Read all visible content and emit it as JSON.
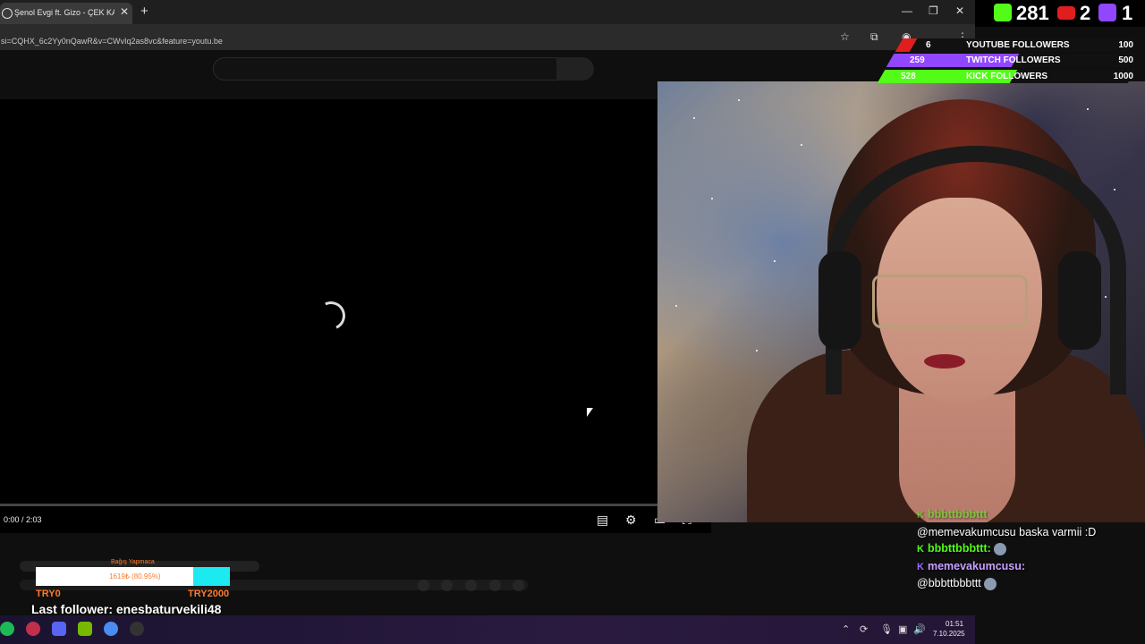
{
  "browser": {
    "tab_title": "Şenol Evgi ft. Gizo - ÇEK KAMER",
    "url": "si=CQHX_6c2Yy0nQawR&v=CWvIq2as8vc&feature=youtu.be",
    "new_tab": "+",
    "close": "✕",
    "minimize": "—",
    "restore": "❐",
    "win_close": "✕",
    "star": "☆"
  },
  "player": {
    "time": "0:00 / 2:03"
  },
  "donation": {
    "title": "Bağış Yapmaca",
    "text": "1619₺ (80.95%)",
    "progress": 0.8095,
    "min_label": "TRY0",
    "max_label": "TRY2000"
  },
  "last_follower": "Last follower: enesbaturvekili48",
  "counters": {
    "kick": "281",
    "youtube": "2",
    "twitch": "1"
  },
  "goals": [
    {
      "current": "6",
      "label": "YOUTUBE FOLLOWERS",
      "target": "100",
      "color": "#e01e1e",
      "progress": 0.06
    },
    {
      "current": "259",
      "label": "TWITCH FOLLOWERS",
      "target": "500",
      "color": "#9146ff",
      "progress": 0.518
    },
    {
      "current": "528",
      "label": "KICK FOLLOWERS",
      "target": "1000",
      "color": "#53fc18",
      "progress": 0.528
    }
  ],
  "chat": [
    {
      "badge": "K",
      "name": "bbbttbbbttt",
      "message": "",
      "faded": true
    },
    {
      "badge": "",
      "name": "",
      "message": "@memevakumcusu baska varmii :D"
    },
    {
      "badge": "K",
      "name": "bbbttbbbttt:",
      "message": ""
    },
    {
      "badge": "K",
      "name": "memevakumcusu:",
      "message": "@bbbttbbbttt",
      "purple": true
    }
  ],
  "taskbar": {
    "time": "01:51",
    "date": "7.10.2025"
  },
  "colors": {
    "kick": "#53fc18",
    "youtube": "#e01e1e",
    "twitch": "#9146ff",
    "donation_bar": "#1de9f0",
    "donation_text": "#ff7a2a"
  }
}
